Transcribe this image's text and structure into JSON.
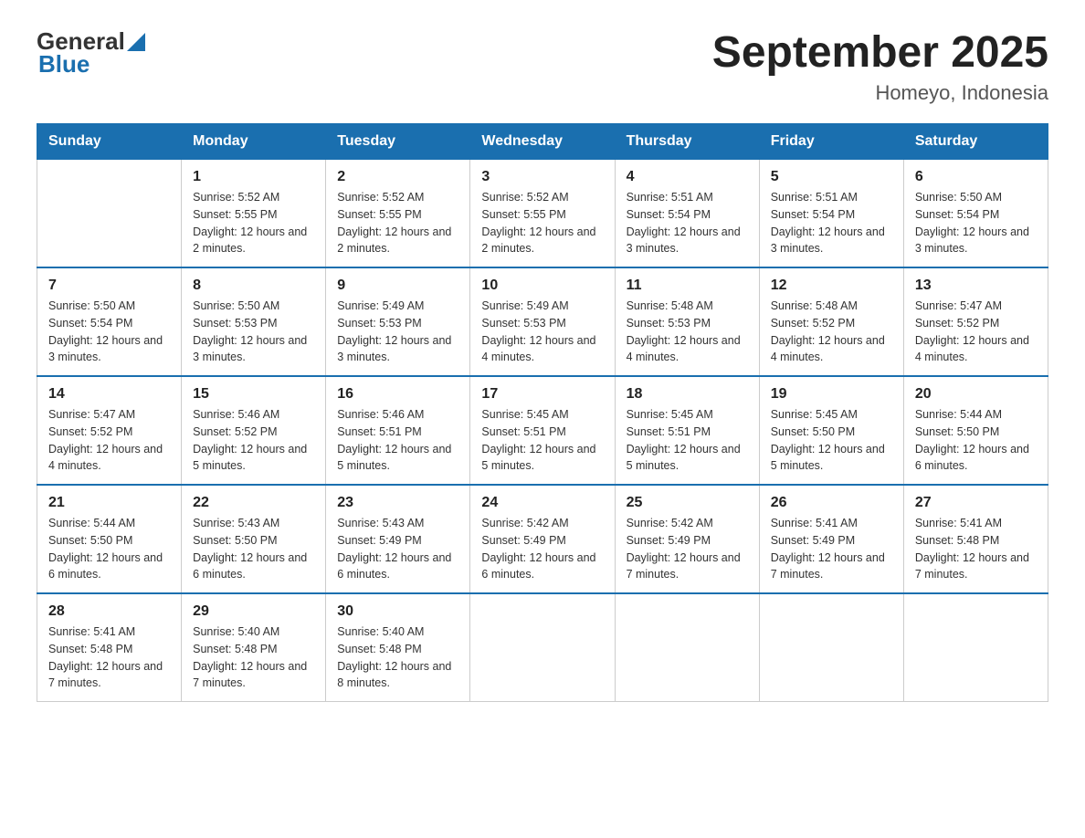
{
  "logo": {
    "general": "General",
    "blue": "Blue"
  },
  "header": {
    "title": "September 2025",
    "subtitle": "Homeyo, Indonesia"
  },
  "days_of_week": [
    "Sunday",
    "Monday",
    "Tuesday",
    "Wednesday",
    "Thursday",
    "Friday",
    "Saturday"
  ],
  "weeks": [
    [
      {
        "day": "",
        "sunrise": "",
        "sunset": "",
        "daylight": ""
      },
      {
        "day": "1",
        "sunrise": "Sunrise: 5:52 AM",
        "sunset": "Sunset: 5:55 PM",
        "daylight": "Daylight: 12 hours and 2 minutes."
      },
      {
        "day": "2",
        "sunrise": "Sunrise: 5:52 AM",
        "sunset": "Sunset: 5:55 PM",
        "daylight": "Daylight: 12 hours and 2 minutes."
      },
      {
        "day": "3",
        "sunrise": "Sunrise: 5:52 AM",
        "sunset": "Sunset: 5:55 PM",
        "daylight": "Daylight: 12 hours and 2 minutes."
      },
      {
        "day": "4",
        "sunrise": "Sunrise: 5:51 AM",
        "sunset": "Sunset: 5:54 PM",
        "daylight": "Daylight: 12 hours and 3 minutes."
      },
      {
        "day": "5",
        "sunrise": "Sunrise: 5:51 AM",
        "sunset": "Sunset: 5:54 PM",
        "daylight": "Daylight: 12 hours and 3 minutes."
      },
      {
        "day": "6",
        "sunrise": "Sunrise: 5:50 AM",
        "sunset": "Sunset: 5:54 PM",
        "daylight": "Daylight: 12 hours and 3 minutes."
      }
    ],
    [
      {
        "day": "7",
        "sunrise": "Sunrise: 5:50 AM",
        "sunset": "Sunset: 5:54 PM",
        "daylight": "Daylight: 12 hours and 3 minutes."
      },
      {
        "day": "8",
        "sunrise": "Sunrise: 5:50 AM",
        "sunset": "Sunset: 5:53 PM",
        "daylight": "Daylight: 12 hours and 3 minutes."
      },
      {
        "day": "9",
        "sunrise": "Sunrise: 5:49 AM",
        "sunset": "Sunset: 5:53 PM",
        "daylight": "Daylight: 12 hours and 3 minutes."
      },
      {
        "day": "10",
        "sunrise": "Sunrise: 5:49 AM",
        "sunset": "Sunset: 5:53 PM",
        "daylight": "Daylight: 12 hours and 4 minutes."
      },
      {
        "day": "11",
        "sunrise": "Sunrise: 5:48 AM",
        "sunset": "Sunset: 5:53 PM",
        "daylight": "Daylight: 12 hours and 4 minutes."
      },
      {
        "day": "12",
        "sunrise": "Sunrise: 5:48 AM",
        "sunset": "Sunset: 5:52 PM",
        "daylight": "Daylight: 12 hours and 4 minutes."
      },
      {
        "day": "13",
        "sunrise": "Sunrise: 5:47 AM",
        "sunset": "Sunset: 5:52 PM",
        "daylight": "Daylight: 12 hours and 4 minutes."
      }
    ],
    [
      {
        "day": "14",
        "sunrise": "Sunrise: 5:47 AM",
        "sunset": "Sunset: 5:52 PM",
        "daylight": "Daylight: 12 hours and 4 minutes."
      },
      {
        "day": "15",
        "sunrise": "Sunrise: 5:46 AM",
        "sunset": "Sunset: 5:52 PM",
        "daylight": "Daylight: 12 hours and 5 minutes."
      },
      {
        "day": "16",
        "sunrise": "Sunrise: 5:46 AM",
        "sunset": "Sunset: 5:51 PM",
        "daylight": "Daylight: 12 hours and 5 minutes."
      },
      {
        "day": "17",
        "sunrise": "Sunrise: 5:45 AM",
        "sunset": "Sunset: 5:51 PM",
        "daylight": "Daylight: 12 hours and 5 minutes."
      },
      {
        "day": "18",
        "sunrise": "Sunrise: 5:45 AM",
        "sunset": "Sunset: 5:51 PM",
        "daylight": "Daylight: 12 hours and 5 minutes."
      },
      {
        "day": "19",
        "sunrise": "Sunrise: 5:45 AM",
        "sunset": "Sunset: 5:50 PM",
        "daylight": "Daylight: 12 hours and 5 minutes."
      },
      {
        "day": "20",
        "sunrise": "Sunrise: 5:44 AM",
        "sunset": "Sunset: 5:50 PM",
        "daylight": "Daylight: 12 hours and 6 minutes."
      }
    ],
    [
      {
        "day": "21",
        "sunrise": "Sunrise: 5:44 AM",
        "sunset": "Sunset: 5:50 PM",
        "daylight": "Daylight: 12 hours and 6 minutes."
      },
      {
        "day": "22",
        "sunrise": "Sunrise: 5:43 AM",
        "sunset": "Sunset: 5:50 PM",
        "daylight": "Daylight: 12 hours and 6 minutes."
      },
      {
        "day": "23",
        "sunrise": "Sunrise: 5:43 AM",
        "sunset": "Sunset: 5:49 PM",
        "daylight": "Daylight: 12 hours and 6 minutes."
      },
      {
        "day": "24",
        "sunrise": "Sunrise: 5:42 AM",
        "sunset": "Sunset: 5:49 PM",
        "daylight": "Daylight: 12 hours and 6 minutes."
      },
      {
        "day": "25",
        "sunrise": "Sunrise: 5:42 AM",
        "sunset": "Sunset: 5:49 PM",
        "daylight": "Daylight: 12 hours and 7 minutes."
      },
      {
        "day": "26",
        "sunrise": "Sunrise: 5:41 AM",
        "sunset": "Sunset: 5:49 PM",
        "daylight": "Daylight: 12 hours and 7 minutes."
      },
      {
        "day": "27",
        "sunrise": "Sunrise: 5:41 AM",
        "sunset": "Sunset: 5:48 PM",
        "daylight": "Daylight: 12 hours and 7 minutes."
      }
    ],
    [
      {
        "day": "28",
        "sunrise": "Sunrise: 5:41 AM",
        "sunset": "Sunset: 5:48 PM",
        "daylight": "Daylight: 12 hours and 7 minutes."
      },
      {
        "day": "29",
        "sunrise": "Sunrise: 5:40 AM",
        "sunset": "Sunset: 5:48 PM",
        "daylight": "Daylight: 12 hours and 7 minutes."
      },
      {
        "day": "30",
        "sunrise": "Sunrise: 5:40 AM",
        "sunset": "Sunset: 5:48 PM",
        "daylight": "Daylight: 12 hours and 8 minutes."
      },
      {
        "day": "",
        "sunrise": "",
        "sunset": "",
        "daylight": ""
      },
      {
        "day": "",
        "sunrise": "",
        "sunset": "",
        "daylight": ""
      },
      {
        "day": "",
        "sunrise": "",
        "sunset": "",
        "daylight": ""
      },
      {
        "day": "",
        "sunrise": "",
        "sunset": "",
        "daylight": ""
      }
    ]
  ]
}
